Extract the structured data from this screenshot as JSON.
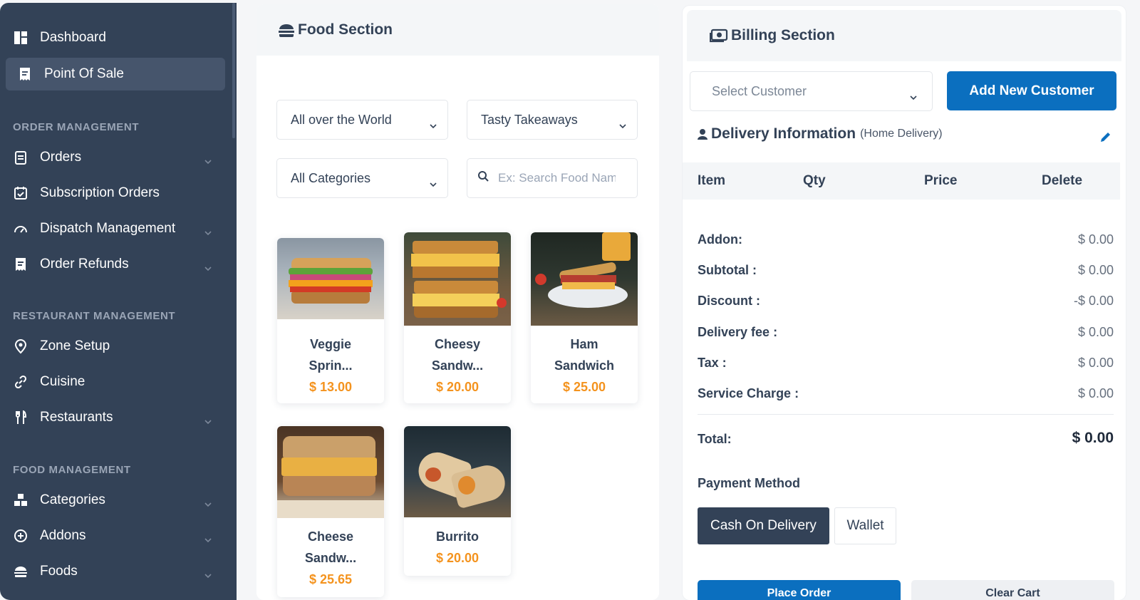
{
  "sidebar": {
    "dashboard": "Dashboard",
    "point_of_sale": "Point Of Sale",
    "sections": {
      "order": "ORDER MANAGEMENT",
      "restaurant": "RESTAURANT MANAGEMENT",
      "food": "FOOD MANAGEMENT"
    },
    "items": {
      "orders": "Orders",
      "subscription_orders": "Subscription Orders",
      "dispatch": "Dispatch Management",
      "refunds": "Order Refunds",
      "zone": "Zone Setup",
      "cuisine": "Cuisine",
      "restaurants": "Restaurants",
      "categories": "Categories",
      "addons": "Addons",
      "foods": "Foods"
    }
  },
  "food": {
    "title": "Food Section",
    "zone_select": "All over the World",
    "restaurant_select": "Tasty Takeaways",
    "category_select": "All Categories",
    "search_placeholder": "Ex: Search Food Name",
    "items": [
      {
        "name_1": "Veggie",
        "name_2": "Sprin...",
        "price": "$ 13.00"
      },
      {
        "name_1": "Cheesy",
        "name_2": "Sandw...",
        "price": "$ 20.00"
      },
      {
        "name_1": "Ham",
        "name_2": "Sandwich",
        "price": "$ 25.00"
      },
      {
        "name_1": "Cheese",
        "name_2": "Sandw...",
        "price": "$ 25.65"
      },
      {
        "name_1": "Burrito",
        "price": "$ 20.00"
      }
    ]
  },
  "billing": {
    "title": "Billing Section",
    "customer_placeholder": "Select Customer",
    "add_customer": "Add New Customer",
    "delivery_title": "Delivery Information",
    "delivery_sub": "(Home Delivery)",
    "columns": {
      "item": "Item",
      "qty": "Qty",
      "price": "Price",
      "delete": "Delete"
    },
    "summary": {
      "addon_label": "Addon:",
      "addon_value": "$ 0.00",
      "subtotal_label": "Subtotal :",
      "subtotal_value": "$ 0.00",
      "discount_label": "Discount :",
      "discount_value": "-$ 0.00",
      "delivery_label": "Delivery fee :",
      "delivery_value": "$ 0.00",
      "tax_label": "Tax :",
      "tax_value": "$ 0.00",
      "service_label": "Service Charge :",
      "service_value": "$ 0.00",
      "total_label": "Total:",
      "total_value": "$ 0.00"
    },
    "payment_title": "Payment Method",
    "payment_cod": "Cash On Delivery",
    "payment_wallet": "Wallet",
    "place_order": "Place Order",
    "clear_cart": "Clear Cart"
  },
  "colors": {
    "sidebar_bg": "#334257",
    "primary": "#0b6fbf",
    "price": "#f4931e"
  }
}
